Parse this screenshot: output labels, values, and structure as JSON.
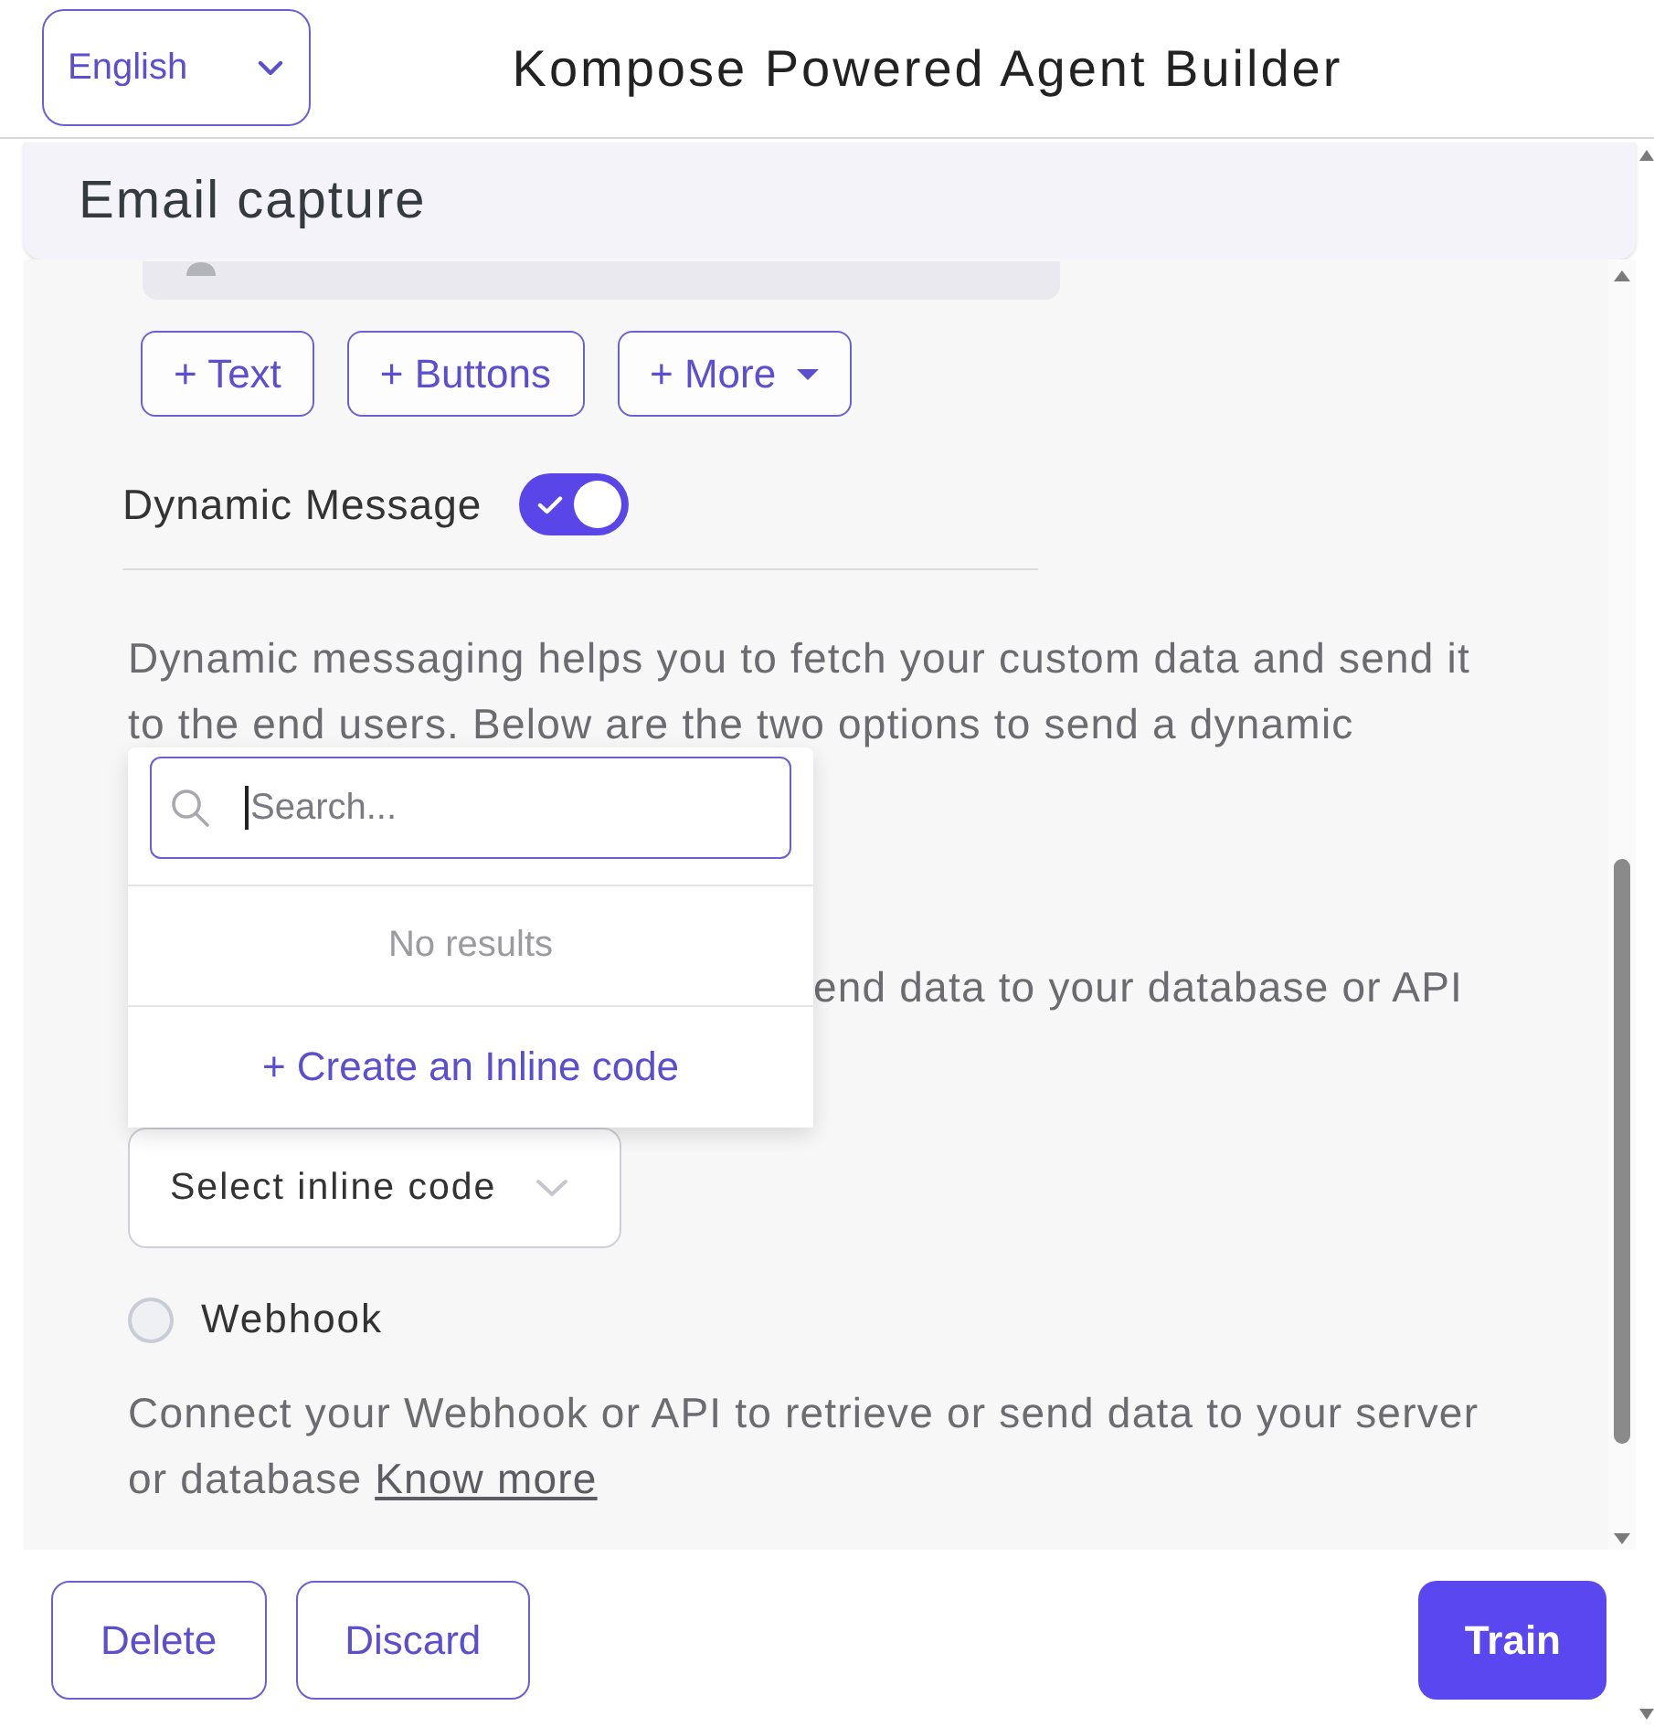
{
  "header": {
    "language": "English",
    "title": "Kompose Powered Agent Builder"
  },
  "panel": {
    "title": "Email capture"
  },
  "add_buttons": [
    {
      "label": "+ Text",
      "kind": "plain"
    },
    {
      "label": "+ Buttons",
      "kind": "plain"
    },
    {
      "label": "+ More",
      "kind": "menu"
    }
  ],
  "dynamic_message": {
    "label": "Dynamic Message",
    "on": true
  },
  "description": "Dynamic messaging helps you to fetch your custom data and send it to the end users. Below are the two options to send a dynamic",
  "inline_code_dropdown": {
    "search": {
      "placeholder": "Search...",
      "focused": true
    },
    "empty_text": "No results",
    "create_action": "+ Create an Inline code"
  },
  "inline_code": {
    "description_fragment": "end data to your database or API",
    "select": "Select inline code"
  },
  "webhook": {
    "label": "Webhook",
    "selected": false,
    "description": "Connect your Webhook or API to retrieve or send data to your server or database",
    "link": "Know more"
  },
  "footer": {
    "buttons": [
      {
        "label": "Delete",
        "kind": "outline"
      },
      {
        "label": "Discard",
        "kind": "outline"
      },
      {
        "label": "Train",
        "kind": "primary"
      }
    ]
  }
}
